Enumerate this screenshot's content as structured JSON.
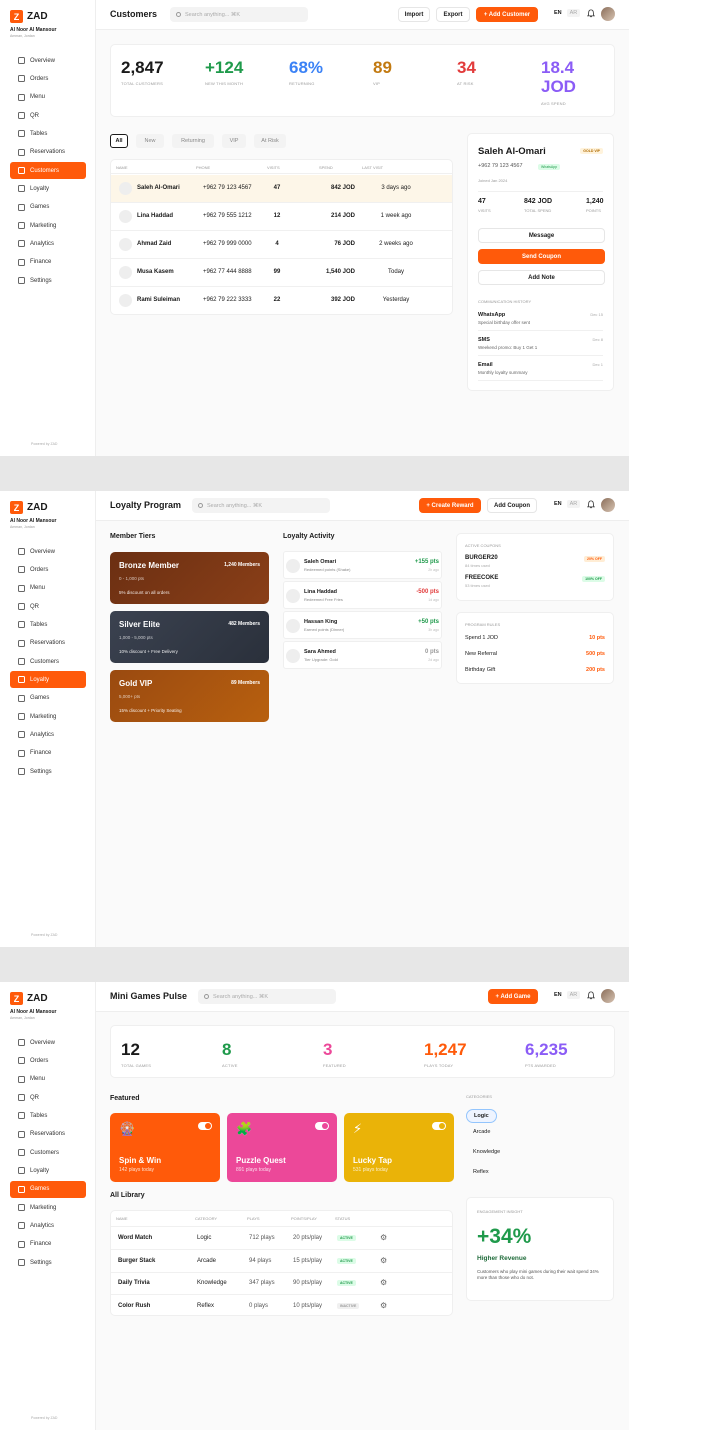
{
  "brand": {
    "name": "ZAD",
    "logo_letter": "Z",
    "business": "Al Noor Al Mansour",
    "location": "Amman, Jordan",
    "powered": "Powered by ZAD"
  },
  "nav": [
    "Overview",
    "Orders",
    "Menu",
    "QR",
    "Tables",
    "Reservations",
    "Customers",
    "Loyalty",
    "Games",
    "Marketing",
    "Analytics",
    "Finance",
    "Settings"
  ],
  "colors": {
    "accent": "#ff5a0a",
    "green": "#1f9a4b",
    "blue": "#3b82f6",
    "amber": "#c27a11",
    "red": "#e23b3b",
    "purple": "#8b5cf6"
  },
  "customers_screen": {
    "title": "Customers",
    "search_placeholder": "Search anything... ⌘K",
    "import": "Import",
    "export": "Export",
    "add": "+ Add Customer",
    "lang_en": "EN",
    "lang_ar": "AR",
    "stats": [
      {
        "value": "2,847",
        "label": "TOTAL CUSTOMERS"
      },
      {
        "value": "+124",
        "label": "NEW THIS MONTH"
      },
      {
        "value": "68%",
        "label": "RETURNING"
      },
      {
        "value": "89",
        "label": "VIP"
      },
      {
        "value": "34",
        "label": "AT RISK"
      },
      {
        "value": "18.4 JOD",
        "label": "AVG SPEND"
      }
    ],
    "filters": [
      "All",
      "New",
      "Returning",
      "VIP",
      "At Risk"
    ],
    "columns": [
      "NAME",
      "PHONE",
      "VISITS",
      "SPEND",
      "LAST VISIT"
    ],
    "rows": [
      {
        "name": "Saleh Al-Omari",
        "phone": "+962 79 123 4567",
        "visits": "47",
        "spend": "842 JOD",
        "last": "3 days ago"
      },
      {
        "name": "Lina Haddad",
        "phone": "+962 79 555 1212",
        "visits": "12",
        "spend": "214 JOD",
        "last": "1 week ago"
      },
      {
        "name": "Ahmad Zaid",
        "phone": "+962 79 999 0000",
        "visits": "4",
        "spend": "76 JOD",
        "last": "2 weeks ago"
      },
      {
        "name": "Musa Kasem",
        "phone": "+962 77 444 8888",
        "visits": "99",
        "spend": "1,540 JOD",
        "last": "Today"
      },
      {
        "name": "Rami Suleiman",
        "phone": "+962 79 222 3333",
        "visits": "22",
        "spend": "392 JOD",
        "last": "Yesterday"
      }
    ],
    "detail": {
      "name": "Saleh Al-Omari",
      "tier": "GOLD VIP",
      "phone": "+962 79 123 4567",
      "channel": "WhatsApp",
      "joined": "Joined Jan 2024",
      "visits": "47",
      "visits_label": "VISITS",
      "spend": "842 JOD",
      "spend_label": "TOTAL SPEND",
      "points": "1,240",
      "points_label": "POINTS",
      "message": "Message",
      "send_coupon": "Send Coupon",
      "add_note": "Add Note",
      "history_title": "COMMUNICATION HISTORY",
      "history": [
        {
          "channel": "WhatsApp",
          "text": "Special birthday offer sent",
          "date": "Dec 15"
        },
        {
          "channel": "SMS",
          "text": "Weekend promo: Buy 1 Get 1",
          "date": "Dec 8"
        },
        {
          "channel": "Email",
          "text": "Monthly loyalty summary",
          "date": "Dec 1"
        }
      ]
    }
  },
  "loyalty_screen": {
    "title": "Loyalty Program",
    "search_placeholder": "Search anything... ⌘K",
    "create": "+ Create Reward",
    "add_coupon": "Add Coupon",
    "tiers_title": "Member Tiers",
    "tiers": [
      {
        "name": "Bronze Member",
        "members": "1,240 Members",
        "range": "0 - 1,000 pts",
        "perk": "5% discount on all orders"
      },
      {
        "name": "Silver Elite",
        "members": "482 Members",
        "range": "1,000 - 5,000 pts",
        "perk": "10% discount + Free Delivery"
      },
      {
        "name": "Gold VIP",
        "members": "89 Members",
        "range": "5,000+ pts",
        "perk": "15% discount + Priority Seating"
      }
    ],
    "activity_title": "Loyalty Activity",
    "activity": [
      {
        "name": "Saleh Omari",
        "desc": "Redeemed points (Shake)",
        "pts": "+155 pts",
        "time": "2h ago"
      },
      {
        "name": "Lina Haddad",
        "desc": "Redeemed Free Fries",
        "pts": "-500 pts",
        "time": "1d ago"
      },
      {
        "name": "Hassan King",
        "desc": "Earned points (Dinner)",
        "pts": "+50 pts",
        "time": "3h ago"
      },
      {
        "name": "Sara Ahmed",
        "desc": "Tier Upgrade: Gold",
        "pts": "0 pts",
        "time": "2d ago"
      }
    ],
    "coupons_title": "ACTIVE COUPONS",
    "coupons": [
      {
        "code": "BURGER20",
        "uses": "84 times used",
        "off": "20% OFF"
      },
      {
        "code": "FREECOKE",
        "uses": "53 times used",
        "off": "100% OFF"
      }
    ],
    "rules_title": "PROGRAM RULES",
    "rules": [
      {
        "label": "Spend 1 JOD",
        "value": "10 pts"
      },
      {
        "label": "New Referral",
        "value": "500 pts"
      },
      {
        "label": "Birthday Gift",
        "value": "200 pts"
      }
    ]
  },
  "games_screen": {
    "title": "Mini Games Pulse",
    "search_placeholder": "Search anything... ⌘K",
    "add": "+ Add Game",
    "stats": [
      {
        "value": "12",
        "label": "TOTAL GAMES"
      },
      {
        "value": "8",
        "label": "ACTIVE"
      },
      {
        "value": "3",
        "label": "FEATURED"
      },
      {
        "value": "1,247",
        "label": "PLAYS TODAY"
      },
      {
        "value": "6,235",
        "label": "PTS AWARDED"
      }
    ],
    "featured_title": "Featured",
    "featured": [
      {
        "name": "Spin & Win",
        "plays": "142 plays today",
        "icon": "🎡",
        "color": "#ff5a0a"
      },
      {
        "name": "Puzzle Quest",
        "plays": "891 plays today",
        "icon": "🧩",
        "color": "#ec4899"
      },
      {
        "name": "Lucky Tap",
        "plays": "531 plays today",
        "icon": "⚡",
        "color": "#eab308"
      }
    ],
    "library_title": "All Library",
    "columns": [
      "NAME",
      "CATEGORY",
      "PLAYS",
      "POINTS/PLAY",
      "STATUS"
    ],
    "rows": [
      {
        "name": "Word Match",
        "category": "Logic",
        "plays": "712 plays",
        "points": "20 pts/play",
        "status": "ACTIVE"
      },
      {
        "name": "Burger Stack",
        "category": "Arcade",
        "plays": "94 plays",
        "points": "15 pts/play",
        "status": "ACTIVE"
      },
      {
        "name": "Daily Trivia",
        "category": "Knowledge",
        "plays": "347 plays",
        "points": "90 pts/play",
        "status": "ACTIVE"
      },
      {
        "name": "Color Rush",
        "category": "Reflex",
        "plays": "0 plays",
        "points": "10 pts/play",
        "status": "INACTIVE"
      }
    ],
    "categories_title": "CATEGORIES",
    "categories": [
      "Logic",
      "Arcade",
      "Knowledge",
      "Reflex"
    ],
    "insight_title": "ENGAGEMENT INSIGHT",
    "insight_value": "+34%",
    "insight_heading": "Higher Revenue",
    "insight_text": "Customers who play mini games during their wait spend 34% more than those who do not."
  }
}
